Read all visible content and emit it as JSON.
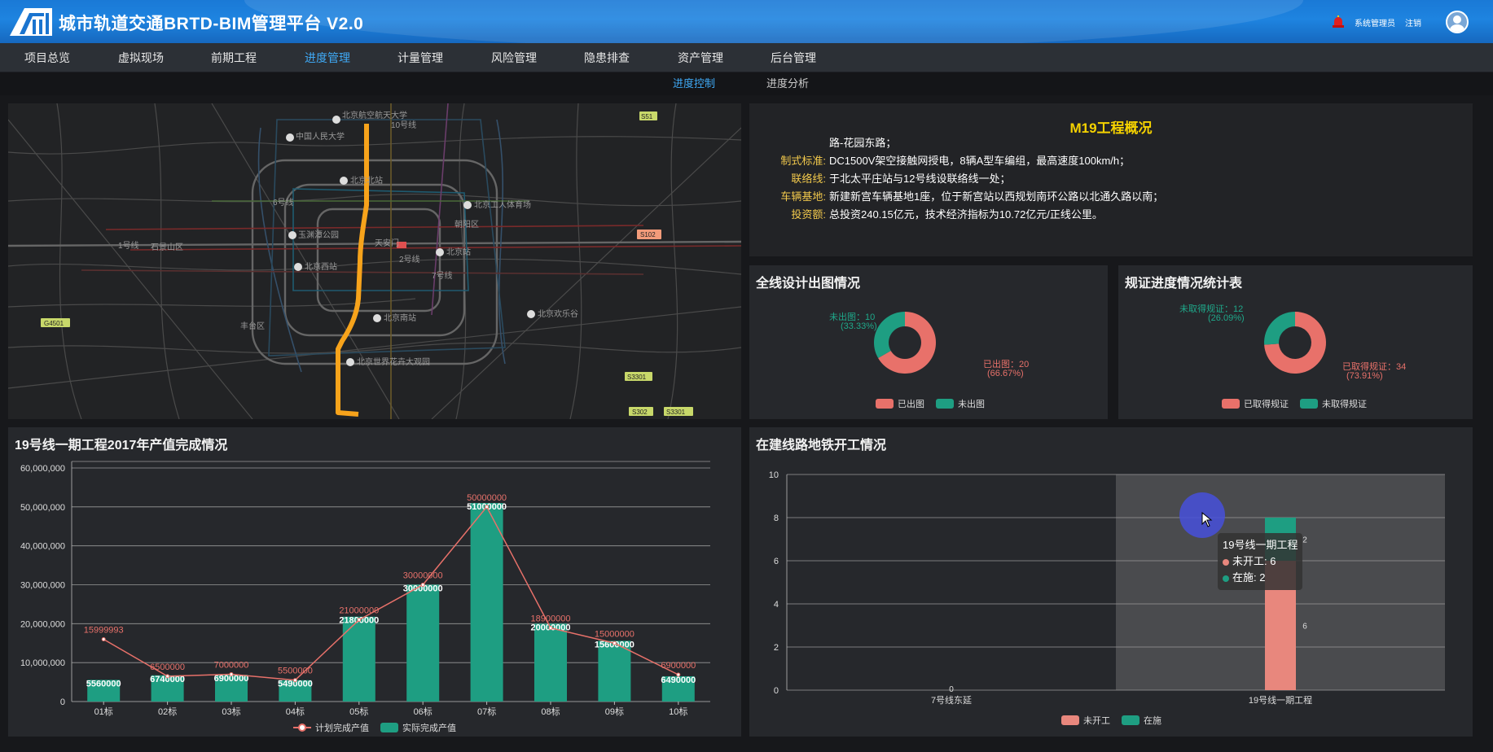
{
  "header": {
    "title": "城市轨道交通BRTD-BIM管理平台 V2.0",
    "user_label": "系统管理员",
    "logout_label": "注销"
  },
  "nav": [
    "项目总览",
    "虚拟现场",
    "前期工程",
    "进度管理",
    "计量管理",
    "风险管理",
    "隐患排查",
    "资产管理",
    "后台管理"
  ],
  "nav_active": "进度管理",
  "subnav": [
    "进度控制",
    "进度分析"
  ],
  "subnav_active": "进度控制",
  "map": {
    "labels": {
      "l1": "北京航空航天大学",
      "l2": "中国人民大学",
      "l3": "北京北站",
      "l4": "北京工人体育场",
      "l5": "玉渊潭公园",
      "l6": "天安门",
      "l7": "北京站",
      "l8": "北京西站",
      "l9": "北京南站",
      "l10": "北京欢乐谷",
      "l11": "北京世界花卉大观园",
      "l12": "朝阳区",
      "l13": "丰台区",
      "l14": "石景山区",
      "l15": "1号线",
      "l16": "2号线",
      "l17": "6号线",
      "l18": "7号线",
      "l19": "10号线",
      "s1": "S51",
      "s2": "S102",
      "s3": "G4501",
      "s4": "S3301",
      "s5": "S302"
    }
  },
  "overview": {
    "title": "M19工程概况",
    "rows": [
      {
        "key": "",
        "value": "路-花园东路；"
      },
      {
        "key": "制式标准:",
        "value": "DC1500V架空接触网授电，8辆A型车编组，最高速度100km/h；"
      },
      {
        "key": "联络线:",
        "value": "于北太平庄站与12号线设联络线一处；"
      },
      {
        "key": "车辆基地:",
        "value": "新建新宫车辆基地1座，位于新宫站以西规划南环公路以北通久路以南；"
      },
      {
        "key": "投资额:",
        "value": "总投资240.15亿元，技术经济指标为10.72亿元/正线公里。"
      }
    ]
  },
  "design_chart": {
    "title": "全线设计出图情况",
    "label_done": "已出图：20",
    "label_done_pct": "(66.67%)",
    "label_todo": "未出图：10",
    "label_todo_pct": "(33.33%)",
    "legend": [
      "已出图",
      "未出图"
    ]
  },
  "permit_chart": {
    "title": "规证进度情况统计表",
    "label_done": "已取得规证：34",
    "label_done_pct": "(73.91%)",
    "label_todo": "未取得规证：12",
    "label_todo_pct": "(26.09%)",
    "legend": [
      "已取得规证",
      "未取得规证"
    ]
  },
  "output_chart": {
    "title": "19号线一期工程2017年产值完成情况",
    "legend": [
      "计划完成产值",
      "实际完成产值"
    ],
    "plan_labels": [
      "15999993",
      "6500000",
      "7000000",
      "5500000",
      "21000000",
      "30000000",
      "50000000",
      "18900000",
      "15000000",
      "6900000"
    ],
    "actual_labels": [
      "5560000",
      "6740000",
      "6900000",
      "5490000",
      "21800000",
      "30000000",
      "51000000",
      "20000000",
      "15600000",
      "6490000"
    ],
    "y_ticks": [
      "0",
      "10,000,000",
      "20,000,000",
      "30,000,000",
      "40,000,000",
      "50,000,000",
      "60,000,000"
    ]
  },
  "start_chart": {
    "title": "在建线路地铁开工情况",
    "legend": [
      "未开工",
      "在施"
    ],
    "y_ticks": [
      "0",
      "2",
      "4",
      "6",
      "8",
      "10"
    ],
    "bar_labels": {
      "zero": "0",
      "not_started": "6",
      "in_progress": "2"
    },
    "tooltip": {
      "title": "19号线一期工程",
      "row1": "未开工: 6",
      "row2": "在施: 2"
    }
  },
  "chart_data": [
    {
      "type": "pie",
      "title": "全线设计出图情况",
      "labels": [
        "已出图",
        "未出图"
      ],
      "values": [
        20,
        10
      ],
      "colors": [
        "#e8716a",
        "#1e9e82"
      ]
    },
    {
      "type": "pie",
      "title": "规证进度情况统计表",
      "labels": [
        "已取得规证",
        "未取得规证"
      ],
      "values": [
        34,
        12
      ],
      "colors": [
        "#e8716a",
        "#1e9e82"
      ]
    },
    {
      "type": "bar",
      "title": "19号线一期工程2017年产值完成情况",
      "categories": [
        "01标",
        "02标",
        "03标",
        "04标",
        "05标",
        "06标",
        "07标",
        "08标",
        "09标",
        "10标"
      ],
      "series": [
        {
          "name": "计划完成产值",
          "kind": "line",
          "values": [
            15999993,
            6500000,
            7000000,
            5500000,
            21000000,
            30000000,
            50000000,
            18900000,
            15000000,
            6900000
          ],
          "color": "#e8716a"
        },
        {
          "name": "实际完成产值",
          "kind": "bar",
          "values": [
            5560000,
            6740000,
            6900000,
            5490000,
            21800000,
            30000000,
            51000000,
            20000000,
            15600000,
            6490000
          ],
          "color": "#1e9e82"
        }
      ],
      "ylim": [
        0,
        60000000
      ]
    },
    {
      "type": "bar",
      "title": "在建线路地铁开工情况",
      "stacked": true,
      "categories": [
        "7号线东延",
        "19号线一期工程"
      ],
      "series": [
        {
          "name": "未开工",
          "values": [
            0,
            6
          ],
          "color": "#e8877d"
        },
        {
          "name": "在施",
          "values": [
            0,
            2
          ],
          "color": "#1e9e82"
        }
      ],
      "ylim": [
        0,
        10
      ]
    }
  ]
}
